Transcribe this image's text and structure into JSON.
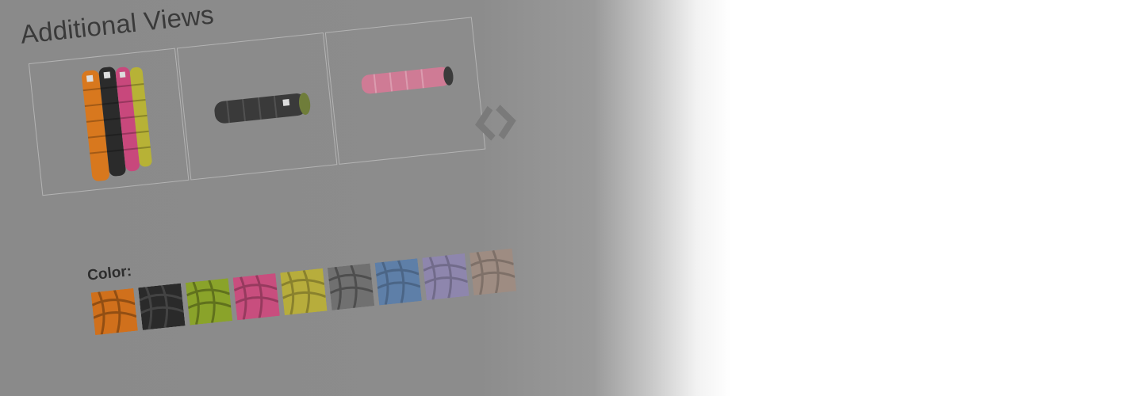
{
  "additional_views": {
    "title": "Additional Views",
    "thumbnails": [
      {
        "name": "multi-color-rollers",
        "colors": [
          "#d8781e",
          "#2b2b2b",
          "#c8487c",
          "#b7b236"
        ]
      },
      {
        "name": "black-roller-side",
        "colors": [
          "#3a3a3a"
        ]
      },
      {
        "name": "pink-roller-side",
        "colors": [
          "#cf7b95"
        ]
      }
    ],
    "navigation_icon": "chevron-pair-icon"
  },
  "color_picker": {
    "label": "Color:",
    "swatches": [
      {
        "name": "orange",
        "hex": "#d0701c"
      },
      {
        "name": "black",
        "hex": "#2a2a2a"
      },
      {
        "name": "lime",
        "hex": "#8aa32a"
      },
      {
        "name": "pink",
        "hex": "#c84e7e"
      },
      {
        "name": "yellow",
        "hex": "#b7ad3c"
      },
      {
        "name": "gray",
        "hex": "#707070"
      },
      {
        "name": "blue",
        "hex": "#5e7fa8"
      },
      {
        "name": "lavender",
        "hex": "#8e86ad"
      },
      {
        "name": "tan",
        "hex": "#9e8c82"
      }
    ]
  }
}
